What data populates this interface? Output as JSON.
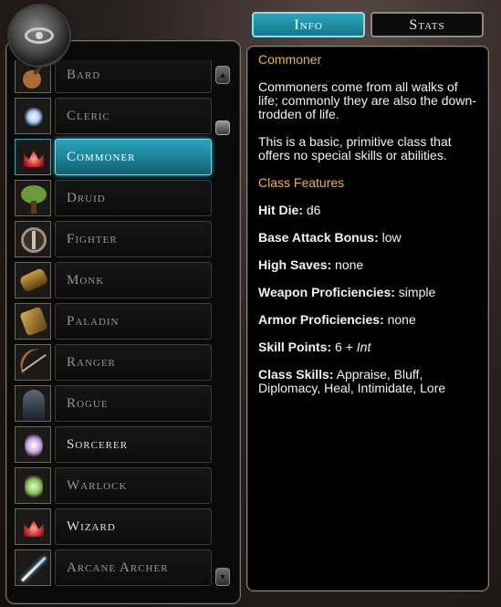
{
  "tabs": {
    "info_label": "Info",
    "stats_label": "Stats",
    "active": "Info"
  },
  "class_list": [
    {
      "label": "Bard",
      "icon": "lute-icon",
      "state": "normal",
      "icon_color": "#b06a35"
    },
    {
      "label": "Cleric",
      "icon": "holy-light-icon",
      "state": "normal",
      "icon_color": "#a8c8ff"
    },
    {
      "label": "Commoner",
      "icon": "commoner-icon",
      "state": "selected",
      "icon_color": "#e04040"
    },
    {
      "label": "Druid",
      "icon": "tree-icon",
      "state": "normal",
      "icon_color": "#6a9a3a"
    },
    {
      "label": "Fighter",
      "icon": "shield-icon",
      "state": "normal",
      "icon_color": "#a09080"
    },
    {
      "label": "Monk",
      "icon": "fist-icon",
      "state": "normal",
      "icon_color": "#c8a040"
    },
    {
      "label": "Paladin",
      "icon": "gauntlet-icon",
      "state": "normal",
      "icon_color": "#d4b050"
    },
    {
      "label": "Ranger",
      "icon": "bow-icon",
      "state": "normal",
      "icon_color": "#9a6a3a"
    },
    {
      "label": "Rogue",
      "icon": "hooded-figure-icon",
      "state": "normal",
      "icon_color": "#5a6a7a"
    },
    {
      "label": "Sorcerer",
      "icon": "magic-hand-icon",
      "state": "bright",
      "icon_color": "#c8a0e0"
    },
    {
      "label": "Warlock",
      "icon": "eldritch-hand-icon",
      "state": "normal",
      "icon_color": "#8ac060"
    },
    {
      "label": "Wizard",
      "icon": "wizard-icon",
      "state": "bright",
      "icon_color": "#e04040"
    },
    {
      "label": "Arcane Archer",
      "icon": "arrow-icon",
      "state": "normal",
      "icon_color": "#9ad8f0"
    }
  ],
  "info": {
    "class_name": "Commoner",
    "description_1": "Commoners come from all walks of life; commonly they are also the down-trodden of life.",
    "description_2": "This is a basic, primitive class that offers no special skills or abilities.",
    "features_title": "Class Features",
    "features": [
      {
        "label": "Hit Die:",
        "value": "d6"
      },
      {
        "label": "Base Attack Bonus:",
        "value": "low"
      },
      {
        "label": "High Saves:",
        "value": "none"
      },
      {
        "label": "Weapon Proficiencies:",
        "value": "simple"
      },
      {
        "label": "Armor Proficiencies:",
        "value": "none"
      },
      {
        "label": "Skill Points:",
        "value": "6 + ",
        "value_italic": "Int"
      },
      {
        "label": "Class Skills:",
        "value": "Appraise, Bluff, Diplomacy, Heal, Intimidate, Lore"
      }
    ]
  },
  "colors": {
    "accent": "#2aa6bd",
    "heading_gold": "#e9b642"
  }
}
